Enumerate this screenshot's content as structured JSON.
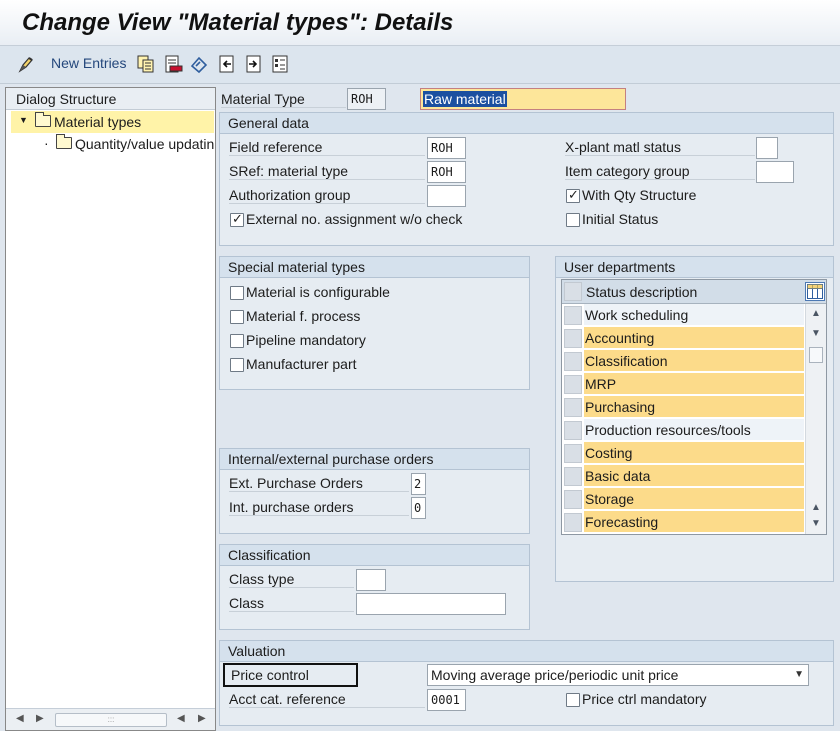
{
  "window": {
    "title": "Change View \"Material types\": Details"
  },
  "toolbar": {
    "new_entries": "New Entries"
  },
  "dialog_structure": {
    "title": "Dialog Structure",
    "items": [
      {
        "label": "Material types",
        "selected": true
      },
      {
        "label": "Quantity/value updatin"
      }
    ]
  },
  "material_type": {
    "label": "Material Type",
    "code": "ROH",
    "description": "Raw material"
  },
  "general_data": {
    "title": "General data",
    "field_reference": {
      "label": "Field reference",
      "value": "ROH"
    },
    "sref_material_type": {
      "label": "SRef: material type",
      "value": "ROH"
    },
    "authorization_group": {
      "label": "Authorization group",
      "value": ""
    },
    "external_no_assignment": {
      "label": "External no. assignment w/o check",
      "checked": true
    },
    "xplant_status": {
      "label": "X-plant matl status",
      "value": ""
    },
    "item_category_group": {
      "label": "Item category group",
      "value": ""
    },
    "with_qty_structure": {
      "label": "With Qty Structure",
      "checked": true
    },
    "initial_status": {
      "label": "Initial Status",
      "checked": false
    }
  },
  "special_material_types": {
    "title": "Special material types",
    "items": [
      {
        "label": "Material is configurable",
        "checked": false
      },
      {
        "label": "Material f. process",
        "checked": false
      },
      {
        "label": "Pipeline mandatory",
        "checked": false
      },
      {
        "label": "Manufacturer part",
        "checked": false
      }
    ]
  },
  "purchase_orders": {
    "title": "Internal/external purchase orders",
    "ext": {
      "label": "Ext. Purchase Orders",
      "value": "2"
    },
    "int": {
      "label": "Int. purchase orders",
      "value": "0"
    }
  },
  "classification": {
    "title": "Classification",
    "class_type": {
      "label": "Class type",
      "value": ""
    },
    "class": {
      "label": "Class",
      "value": ""
    }
  },
  "user_departments": {
    "title": "User departments",
    "column": "Status description",
    "rows": [
      {
        "label": "Work scheduling",
        "highlighted": false
      },
      {
        "label": "Accounting",
        "highlighted": true
      },
      {
        "label": "Classification",
        "highlighted": true
      },
      {
        "label": "MRP",
        "highlighted": true
      },
      {
        "label": "Purchasing",
        "highlighted": true
      },
      {
        "label": "Production resources/tools",
        "highlighted": false
      },
      {
        "label": "Costing",
        "highlighted": true
      },
      {
        "label": "Basic data",
        "highlighted": true
      },
      {
        "label": "Storage",
        "highlighted": true
      },
      {
        "label": "Forecasting",
        "highlighted": true
      }
    ]
  },
  "valuation": {
    "title": "Valuation",
    "price_control": {
      "label": "Price control",
      "value": "Moving average price/periodic unit price"
    },
    "acct_cat_reference": {
      "label": "Acct cat. reference",
      "value": "0001"
    },
    "price_ctrl_mandatory": {
      "label": "Price ctrl mandatory",
      "checked": false
    }
  },
  "colors": {
    "highlight": "#fcdb8a",
    "selection": "#1b4fa0",
    "group_header": "#d5e1ed",
    "background": "#dfe6ee"
  },
  "icons": {
    "toolbar": [
      "display-change-icon",
      "copy-icon",
      "delete-icon",
      "undo-icon",
      "previous-entry-icon",
      "next-entry-icon",
      "select-all-icon"
    ]
  }
}
